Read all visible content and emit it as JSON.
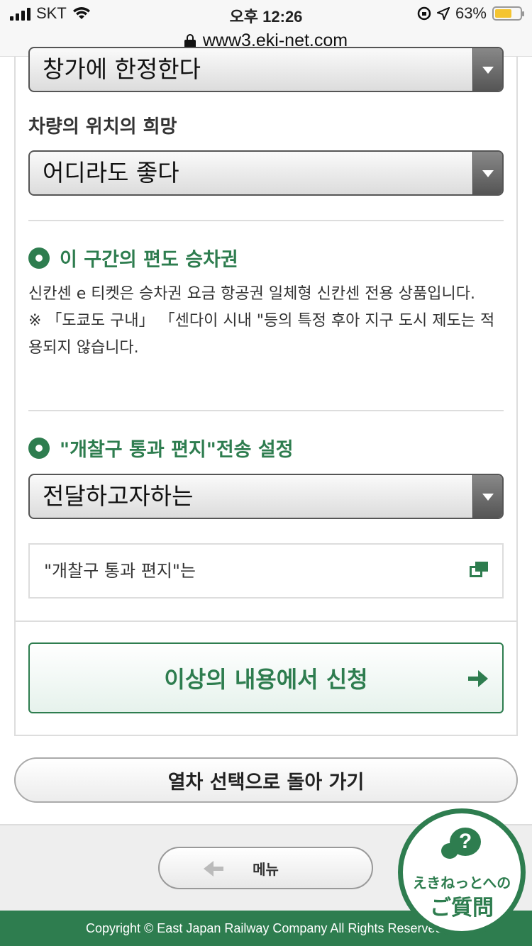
{
  "status_bar": {
    "carrier": "SKT",
    "time": "오후 12:26",
    "battery_percent": "63%",
    "battery_level": 0.63
  },
  "browser": {
    "url": "www3.eki-net.com"
  },
  "form": {
    "partial_select_value": "창가에 한정한다",
    "car_position_label": "차량의 위치의 희망",
    "car_position_value": "어디라도 좋다"
  },
  "one_way_section": {
    "title": "이 구간의 편도 승차권",
    "paragraph1": "신칸센 e 티켓은 승차권 요금 항공권 일체형 신칸센 전용 상품입니다.",
    "paragraph2": "※ 「도쿄도 구내」 「센다이 시내 \"등의 특정 후아 지구 도시 제도는 적용되지 않습니다."
  },
  "gate_mail_section": {
    "title": "\"개찰구 통과 편지\"전송 설정",
    "select_value": "전달하고자하는",
    "info_link": "\"개찰구 통과 편지\"는"
  },
  "actions": {
    "submit_label": "이상의 내용에서 신청",
    "back_label": "열차 선택으로 돌아 가기",
    "menu_label": "메뉴"
  },
  "footer": {
    "copyright": "Copyright © East Japan Railway Company All Rights Reserved."
  },
  "faq_badge": {
    "line1": "えきねっとへの",
    "line2": "ご質問",
    "symbol": "?"
  },
  "colors": {
    "brand_green": "#2e7d4f"
  },
  "icons": [
    "wifi-icon",
    "signal-icon",
    "lock-icon",
    "location-icon",
    "orientation-lock-icon",
    "battery-icon",
    "dropdown-arrow-icon",
    "new-window-icon",
    "arrow-right-icon",
    "arrow-left-icon",
    "question-bubble-icon"
  ]
}
